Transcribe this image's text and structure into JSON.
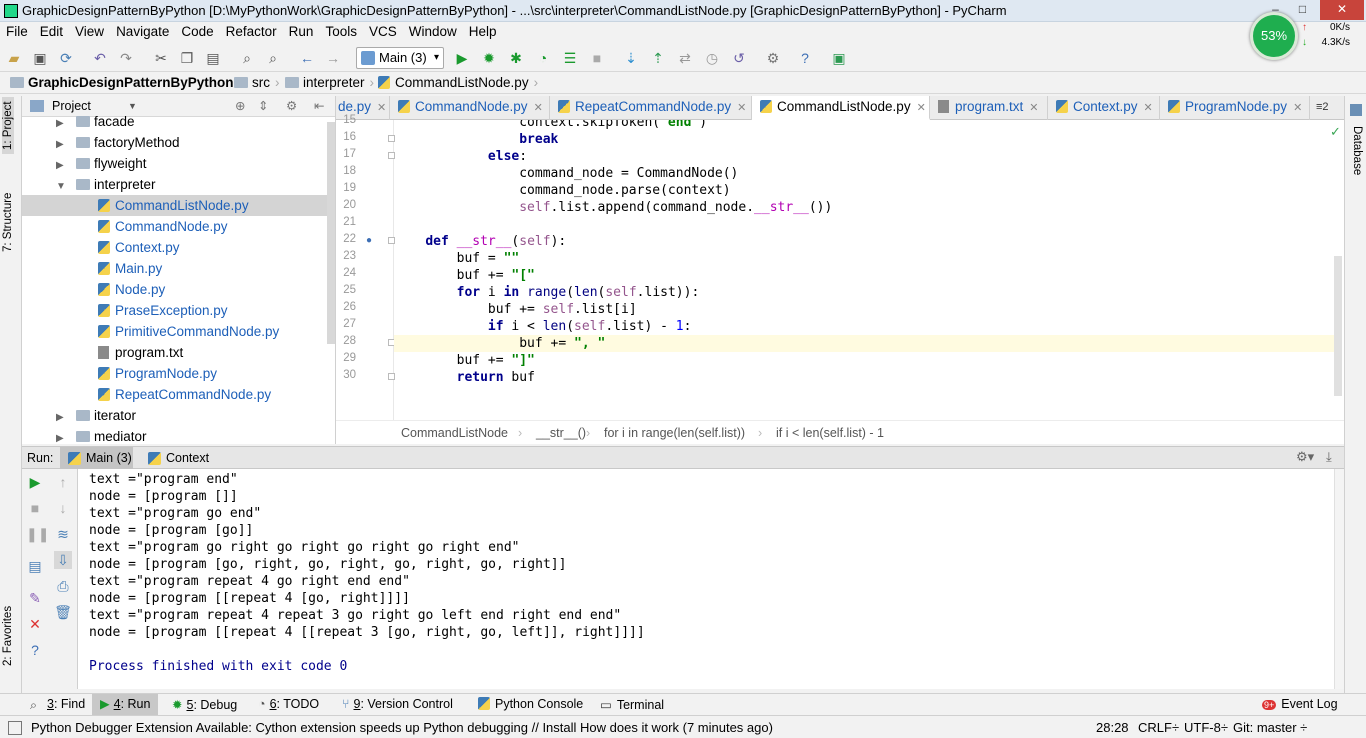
{
  "window": {
    "title": "GraphicDesignPatternByPython [D:\\MyPythonWork\\GraphicDesignPatternByPython] - ...\\src\\interpreter\\CommandListNode.py [GraphicDesignPatternByPython] - PyCharm",
    "minimize": "–",
    "maximize": "□",
    "close": "✕"
  },
  "menu": [
    "File",
    "Edit",
    "View",
    "Navigate",
    "Code",
    "Refactor",
    "Run",
    "Tools",
    "VCS",
    "Window",
    "Help"
  ],
  "toolbar": {
    "run_config": "Main (3)"
  },
  "perf": {
    "cpu": "53%",
    "up": "0K/s",
    "down": "4.3K/s"
  },
  "breadcrumb": [
    "GraphicDesignPatternByPython",
    "src",
    "interpreter",
    "CommandListNode.py"
  ],
  "project": {
    "title": "Project",
    "tree": [
      {
        "label": "facade",
        "kind": "folder",
        "depth": 1
      },
      {
        "label": "factoryMethod",
        "kind": "folder",
        "depth": 1
      },
      {
        "label": "flyweight",
        "kind": "folder",
        "depth": 1
      },
      {
        "label": "interpreter",
        "kind": "folder-open",
        "depth": 1
      },
      {
        "label": "CommandListNode.py",
        "kind": "py",
        "depth": 2,
        "selected": true
      },
      {
        "label": "CommandNode.py",
        "kind": "py",
        "depth": 2
      },
      {
        "label": "Context.py",
        "kind": "py",
        "depth": 2
      },
      {
        "label": "Main.py",
        "kind": "py",
        "depth": 2
      },
      {
        "label": "Node.py",
        "kind": "py",
        "depth": 2
      },
      {
        "label": "PraseException.py",
        "kind": "py",
        "depth": 2
      },
      {
        "label": "PrimitiveCommandNode.py",
        "kind": "py",
        "depth": 2
      },
      {
        "label": "program.txt",
        "kind": "txt",
        "depth": 2
      },
      {
        "label": "ProgramNode.py",
        "kind": "py",
        "depth": 2
      },
      {
        "label": "RepeatCommandNode.py",
        "kind": "py",
        "depth": 2
      },
      {
        "label": "iterator",
        "kind": "folder",
        "depth": 1
      },
      {
        "label": "mediator",
        "kind": "folder",
        "depth": 1
      }
    ]
  },
  "editor": {
    "tabs": [
      "de.py",
      "CommandNode.py",
      "RepeatCommandNode.py",
      "CommandListNode.py",
      "program.txt",
      "Context.py",
      "ProgramNode.py"
    ],
    "active_tab": "CommandListNode.py",
    "tab_overflow": "≡2",
    "line_numbers": [
      "15",
      "16",
      "17",
      "18",
      "19",
      "20",
      "21",
      "22",
      "23",
      "24",
      "25",
      "26",
      "27",
      "28",
      "29",
      "30"
    ],
    "breadcrumb": [
      "CommandListNode",
      "__str__()",
      "for i in range(len(self.list))",
      "if i < len(self.list) - 1"
    ]
  },
  "run": {
    "label": "Run:",
    "tabs": [
      "Main (3)",
      "Context"
    ],
    "output": [
      "text =\"program end\"",
      "node = [program []]",
      "text =\"program go end\"",
      "node = [program [go]]",
      "text =\"program go right go right go right go right end\"",
      "node = [program [go, right, go, right, go, right, go, right]]",
      "text =\"program repeat 4 go right end end\"",
      "node = [program [[repeat 4 [go, right]]]]",
      "text =\"program repeat 4 repeat 3 go right go left end right end end\"",
      "node = [program [[repeat 4 [[repeat 3 [go, right, go, left]], right]]]]",
      "",
      "Process finished with exit code 0"
    ]
  },
  "side_tabs": {
    "project": "1: Project",
    "structure": "7: Structure",
    "favorites": "2: Favorites",
    "database": "Database"
  },
  "tool_windows": [
    {
      "key": "3",
      "label": ": Find"
    },
    {
      "key": "4",
      "label": ": Run"
    },
    {
      "key": "5",
      "label": ": Debug"
    },
    {
      "key": "6",
      "label": ": TODO"
    },
    {
      "key": "9",
      "label": ": Version Control"
    },
    {
      "key": "",
      "label": "Python Console"
    },
    {
      "key": "",
      "label": "Terminal"
    }
  ],
  "event_log": "Event Log",
  "event_badge": "9+",
  "status": {
    "message": "Python Debugger Extension Available: Cython extension speeds up Python debugging // Install How does it work (7 minutes ago)",
    "position": "28:28",
    "line_sep": "CRLF÷",
    "encoding": "UTF-8÷",
    "git": "Git: master ÷"
  }
}
